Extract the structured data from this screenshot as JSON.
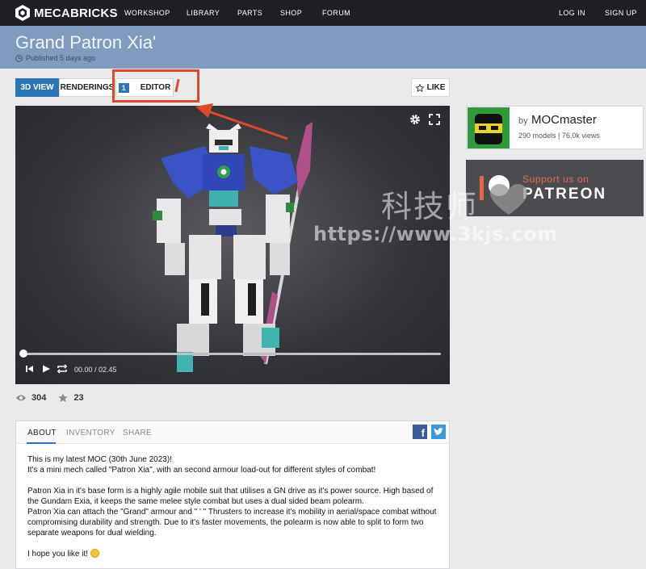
{
  "nav": {
    "logo": "MECABRICKS",
    "items": [
      "WORKSHOP",
      "LIBRARY",
      "PARTS",
      "SHOP",
      "FORUM"
    ],
    "login": "LOG IN",
    "signup": "SIGN UP"
  },
  "page": {
    "title": "Grand Patron Xia'",
    "published": "Published 5 days ago"
  },
  "tabs": {
    "view3d": "3D VIEW",
    "renderings": "RENDERINGS",
    "editor_badge": "1",
    "editor": "EDITOR",
    "like": "LIKE"
  },
  "player": {
    "time": "00.00 / 02.45",
    "progress": 0
  },
  "stats": {
    "views": "304",
    "stars": "23"
  },
  "author": {
    "by": "by",
    "name": "MOCmaster",
    "counts": "290 models | 76.0k views"
  },
  "patreon": {
    "support": "Support us on",
    "name": "PATREON"
  },
  "watermark": {
    "chinese": "科技师",
    "url": "https://www.3kjs.com"
  },
  "description": {
    "tabs": [
      "ABOUT",
      "INVENTORY",
      "SHARE"
    ],
    "paragraphs": [
      [
        "This is my latest MOC (30th June 2023)!",
        "It's a mini mech called \"Patron Xia\", with an second armour load-out for different styles of combat!"
      ],
      [
        "Patron Xia in it's base form is a highly agile mobile suit that utilises a GN drive as it's power source. High based of the Gundam Exia, it keeps the same melee style combat but uses a dual sided beam polearm.",
        "Patron Xia can attach the \"Grand\" armour and \" ' \" Thrusters to increase it's mobility in aerial/space combat without compromising durability and strength. Due to it's faster movements, the polearm is now able to split to form two separate weapons for dual wielding."
      ],
      [
        "I hope you like it!"
      ]
    ]
  },
  "colors": {
    "accent": "#2a74b7",
    "title_band": "#7f9bbd",
    "annotation": "#e0482b",
    "patreon_orange": "#f0684a"
  }
}
